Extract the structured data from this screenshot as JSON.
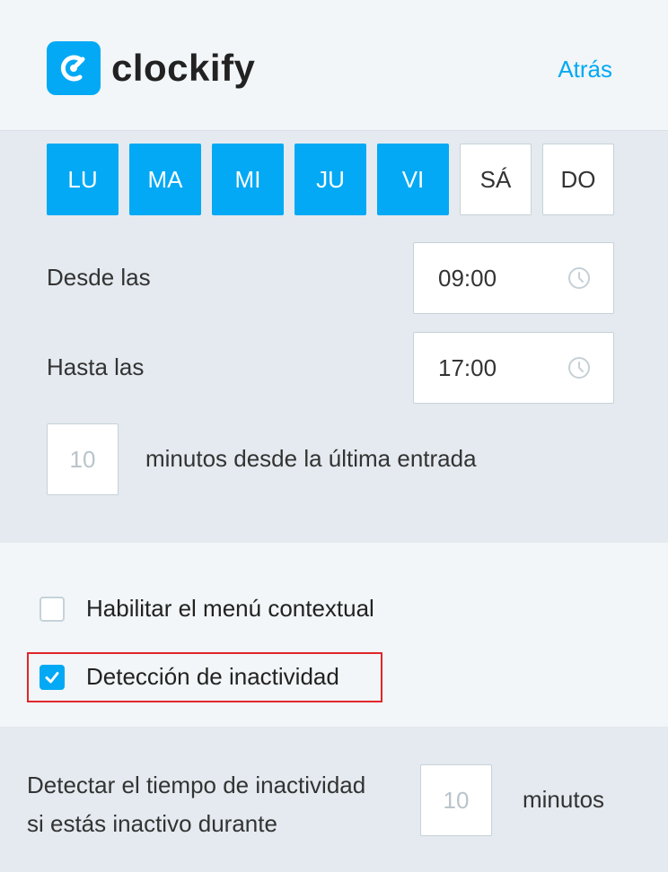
{
  "header": {
    "logo_text": "clockify",
    "back_label": "Atrás",
    "brand_color": "#03a9f4"
  },
  "days": [
    {
      "label": "LU",
      "selected": true
    },
    {
      "label": "MA",
      "selected": true
    },
    {
      "label": "MI",
      "selected": true
    },
    {
      "label": "JU",
      "selected": true
    },
    {
      "label": "VI",
      "selected": true
    },
    {
      "label": "SÁ",
      "selected": false
    },
    {
      "label": "DO",
      "selected": false
    }
  ],
  "schedule": {
    "from_label": "Desde las",
    "from_value": "09:00",
    "to_label": "Hasta las",
    "to_value": "17:00",
    "reminder_placeholder": "10",
    "reminder_label": "minutos desde la última entrada"
  },
  "options": {
    "context_menu_label": "Habilitar el menú contextual",
    "context_menu_checked": false,
    "idle_detection_label": "Detección de inactividad",
    "idle_detection_checked": true
  },
  "idle": {
    "label_line1": "Detectar el tiempo de inactividad",
    "label_line2": "si estás inactivo durante",
    "minutes_placeholder": "10",
    "minutes_label": "minutos"
  }
}
